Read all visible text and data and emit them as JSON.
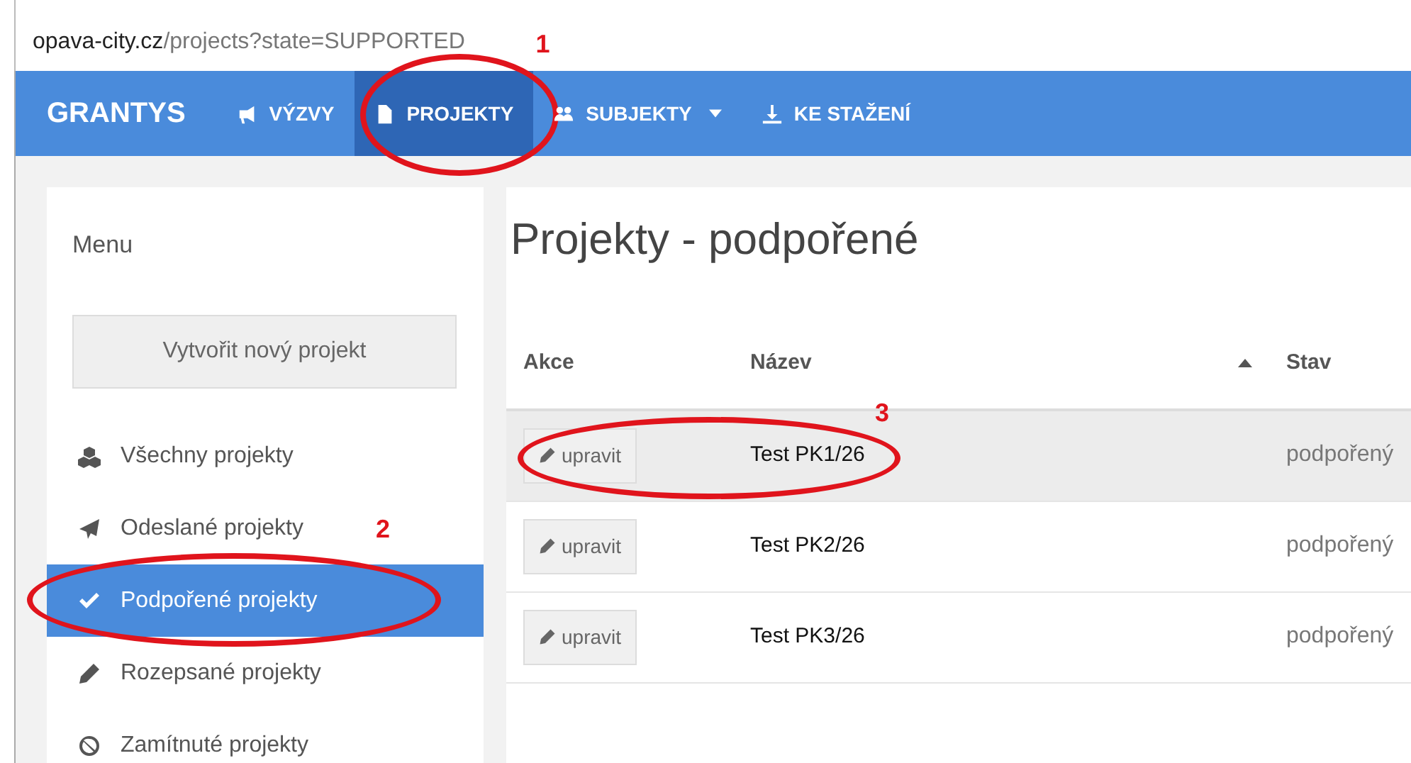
{
  "address_bar": {
    "domain": "opava-city.cz",
    "path": "/projects?state=SUPPORTED"
  },
  "navbar": {
    "brand": "GRANTYS",
    "items": [
      {
        "label": "VÝZVY",
        "selected": false,
        "dropdown": false
      },
      {
        "label": "PROJEKTY",
        "selected": true,
        "dropdown": false,
        "annotation": "1"
      },
      {
        "label": "SUBJEKTY",
        "selected": false,
        "dropdown": true
      },
      {
        "label": "KE STAŽENÍ",
        "selected": false,
        "dropdown": false
      }
    ]
  },
  "sidebar": {
    "title": "Menu",
    "create_button": "Vytvořit nový projekt",
    "items": [
      {
        "label": "Všechny projekty",
        "selected": false
      },
      {
        "label": "Odeslané projekty",
        "selected": false
      },
      {
        "label": "Podpořené projekty",
        "selected": true,
        "annotation": "2"
      },
      {
        "label": "Rozepsané projekty",
        "selected": false
      },
      {
        "label": "Zamítnuté projekty",
        "selected": false
      }
    ]
  },
  "page_title": "Projekty - podpořené",
  "table": {
    "columns": [
      {
        "label": "Akce",
        "sorted": false
      },
      {
        "label": "Název",
        "sorted": true
      },
      {
        "label": "Stav",
        "sorted": false
      }
    ],
    "rows": [
      {
        "action": "upravit",
        "name": "Test PK1/26",
        "state": "podpořený",
        "hovered": true,
        "annotation": "3"
      },
      {
        "action": "upravit",
        "name": "Test PK2/26",
        "state": "podpořený",
        "hovered": false
      },
      {
        "action": "upravit",
        "name": "Test PK3/26",
        "state": "podpořený",
        "hovered": false
      }
    ]
  }
}
